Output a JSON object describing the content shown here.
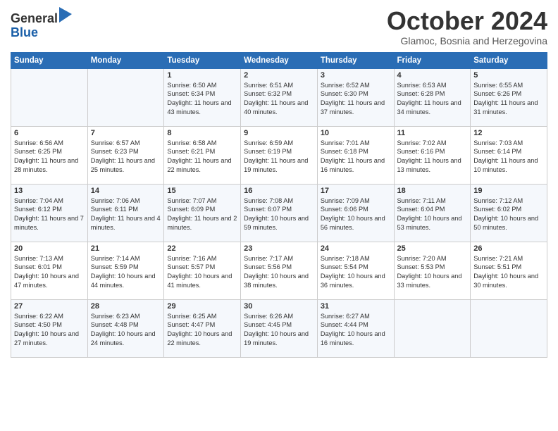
{
  "header": {
    "logo_line1": "General",
    "logo_line2": "Blue",
    "month_title": "October 2024",
    "subtitle": "Glamoc, Bosnia and Herzegovina"
  },
  "weekdays": [
    "Sunday",
    "Monday",
    "Tuesday",
    "Wednesday",
    "Thursday",
    "Friday",
    "Saturday"
  ],
  "weeks": [
    [
      {
        "day": "",
        "info": ""
      },
      {
        "day": "",
        "info": ""
      },
      {
        "day": "1",
        "info": "Sunrise: 6:50 AM\nSunset: 6:34 PM\nDaylight: 11 hours and 43 minutes."
      },
      {
        "day": "2",
        "info": "Sunrise: 6:51 AM\nSunset: 6:32 PM\nDaylight: 11 hours and 40 minutes."
      },
      {
        "day": "3",
        "info": "Sunrise: 6:52 AM\nSunset: 6:30 PM\nDaylight: 11 hours and 37 minutes."
      },
      {
        "day": "4",
        "info": "Sunrise: 6:53 AM\nSunset: 6:28 PM\nDaylight: 11 hours and 34 minutes."
      },
      {
        "day": "5",
        "info": "Sunrise: 6:55 AM\nSunset: 6:26 PM\nDaylight: 11 hours and 31 minutes."
      }
    ],
    [
      {
        "day": "6",
        "info": "Sunrise: 6:56 AM\nSunset: 6:25 PM\nDaylight: 11 hours and 28 minutes."
      },
      {
        "day": "7",
        "info": "Sunrise: 6:57 AM\nSunset: 6:23 PM\nDaylight: 11 hours and 25 minutes."
      },
      {
        "day": "8",
        "info": "Sunrise: 6:58 AM\nSunset: 6:21 PM\nDaylight: 11 hours and 22 minutes."
      },
      {
        "day": "9",
        "info": "Sunrise: 6:59 AM\nSunset: 6:19 PM\nDaylight: 11 hours and 19 minutes."
      },
      {
        "day": "10",
        "info": "Sunrise: 7:01 AM\nSunset: 6:18 PM\nDaylight: 11 hours and 16 minutes."
      },
      {
        "day": "11",
        "info": "Sunrise: 7:02 AM\nSunset: 6:16 PM\nDaylight: 11 hours and 13 minutes."
      },
      {
        "day": "12",
        "info": "Sunrise: 7:03 AM\nSunset: 6:14 PM\nDaylight: 11 hours and 10 minutes."
      }
    ],
    [
      {
        "day": "13",
        "info": "Sunrise: 7:04 AM\nSunset: 6:12 PM\nDaylight: 11 hours and 7 minutes."
      },
      {
        "day": "14",
        "info": "Sunrise: 7:06 AM\nSunset: 6:11 PM\nDaylight: 11 hours and 4 minutes."
      },
      {
        "day": "15",
        "info": "Sunrise: 7:07 AM\nSunset: 6:09 PM\nDaylight: 11 hours and 2 minutes."
      },
      {
        "day": "16",
        "info": "Sunrise: 7:08 AM\nSunset: 6:07 PM\nDaylight: 10 hours and 59 minutes."
      },
      {
        "day": "17",
        "info": "Sunrise: 7:09 AM\nSunset: 6:06 PM\nDaylight: 10 hours and 56 minutes."
      },
      {
        "day": "18",
        "info": "Sunrise: 7:11 AM\nSunset: 6:04 PM\nDaylight: 10 hours and 53 minutes."
      },
      {
        "day": "19",
        "info": "Sunrise: 7:12 AM\nSunset: 6:02 PM\nDaylight: 10 hours and 50 minutes."
      }
    ],
    [
      {
        "day": "20",
        "info": "Sunrise: 7:13 AM\nSunset: 6:01 PM\nDaylight: 10 hours and 47 minutes."
      },
      {
        "day": "21",
        "info": "Sunrise: 7:14 AM\nSunset: 5:59 PM\nDaylight: 10 hours and 44 minutes."
      },
      {
        "day": "22",
        "info": "Sunrise: 7:16 AM\nSunset: 5:57 PM\nDaylight: 10 hours and 41 minutes."
      },
      {
        "day": "23",
        "info": "Sunrise: 7:17 AM\nSunset: 5:56 PM\nDaylight: 10 hours and 38 minutes."
      },
      {
        "day": "24",
        "info": "Sunrise: 7:18 AM\nSunset: 5:54 PM\nDaylight: 10 hours and 36 minutes."
      },
      {
        "day": "25",
        "info": "Sunrise: 7:20 AM\nSunset: 5:53 PM\nDaylight: 10 hours and 33 minutes."
      },
      {
        "day": "26",
        "info": "Sunrise: 7:21 AM\nSunset: 5:51 PM\nDaylight: 10 hours and 30 minutes."
      }
    ],
    [
      {
        "day": "27",
        "info": "Sunrise: 6:22 AM\nSunset: 4:50 PM\nDaylight: 10 hours and 27 minutes."
      },
      {
        "day": "28",
        "info": "Sunrise: 6:23 AM\nSunset: 4:48 PM\nDaylight: 10 hours and 24 minutes."
      },
      {
        "day": "29",
        "info": "Sunrise: 6:25 AM\nSunset: 4:47 PM\nDaylight: 10 hours and 22 minutes."
      },
      {
        "day": "30",
        "info": "Sunrise: 6:26 AM\nSunset: 4:45 PM\nDaylight: 10 hours and 19 minutes."
      },
      {
        "day": "31",
        "info": "Sunrise: 6:27 AM\nSunset: 4:44 PM\nDaylight: 10 hours and 16 minutes."
      },
      {
        "day": "",
        "info": ""
      },
      {
        "day": "",
        "info": ""
      }
    ]
  ]
}
